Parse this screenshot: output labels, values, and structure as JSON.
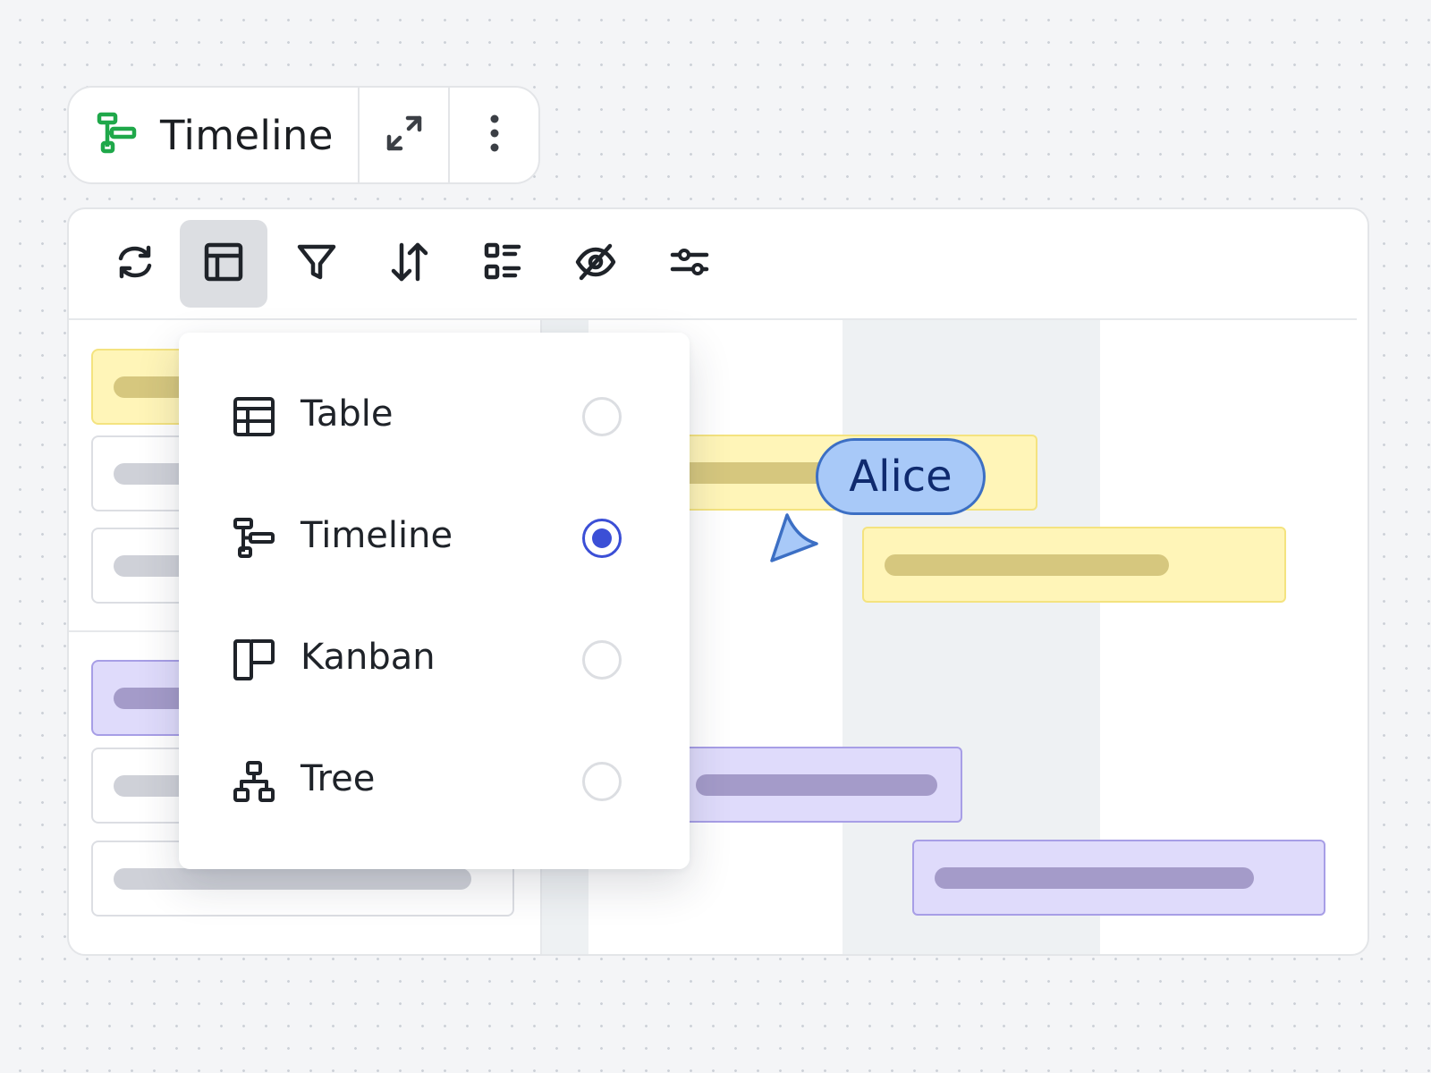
{
  "header": {
    "title": "Timeline",
    "icon": "timeline-icon",
    "expand_icon": "expand-icon",
    "more_icon": "more-vertical-icon",
    "accent": "#1fa84a"
  },
  "toolbar": {
    "tools": [
      {
        "name": "refresh",
        "icon": "refresh-icon"
      },
      {
        "name": "layout",
        "icon": "layout-icon",
        "active": true
      },
      {
        "name": "filter",
        "icon": "filter-icon"
      },
      {
        "name": "sort",
        "icon": "sort-icon"
      },
      {
        "name": "group",
        "icon": "list-group-icon"
      },
      {
        "name": "hide",
        "icon": "eye-off-icon"
      },
      {
        "name": "settings",
        "icon": "sliders-icon"
      }
    ]
  },
  "layout_menu": {
    "selected": "Timeline",
    "options": [
      {
        "label": "Table",
        "icon": "table-icon",
        "checked": false
      },
      {
        "label": "Timeline",
        "icon": "timeline-icon",
        "checked": true
      },
      {
        "label": "Kanban",
        "icon": "kanban-icon",
        "checked": false
      },
      {
        "label": "Tree",
        "icon": "tree-icon",
        "checked": false
      }
    ],
    "radio_color": "#3b4fd6"
  },
  "collaborator": {
    "name": "Alice",
    "color": "#a8c9f8"
  },
  "colors": {
    "yellow_group": "#fff5b8",
    "purple_group": "#dfdbfb"
  }
}
